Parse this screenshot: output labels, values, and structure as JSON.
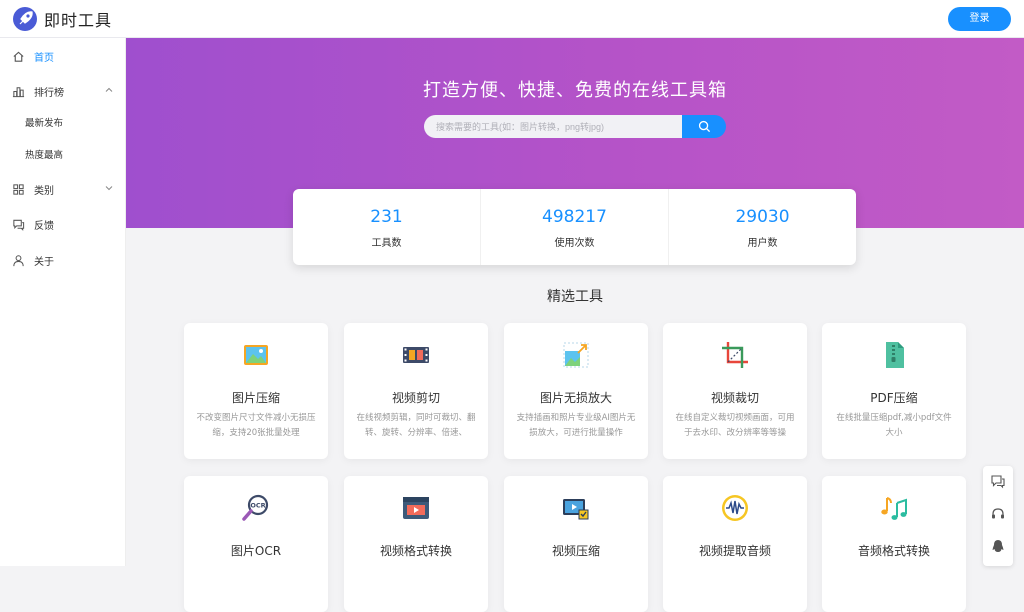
{
  "app": {
    "name": "即时工具"
  },
  "header": {
    "login_label": "登录"
  },
  "sidebar": {
    "items": [
      {
        "label": "首页",
        "icon": "home-icon",
        "active": true
      },
      {
        "label": "排行榜",
        "icon": "bar-chart-icon",
        "expanded": true,
        "children": [
          {
            "label": "最新发布"
          },
          {
            "label": "热度最高"
          }
        ]
      },
      {
        "label": "类别",
        "icon": "grid-icon",
        "expanded": false
      },
      {
        "label": "反馈",
        "icon": "feedback-icon"
      },
      {
        "label": "关于",
        "icon": "user-icon"
      }
    ]
  },
  "hero": {
    "title": "打造方便、快捷、免费的在线工具箱",
    "search_placeholder": "搜索需要的工具(如：图片转换，png转jpg)"
  },
  "stats": [
    {
      "value": "231",
      "label": "工具数"
    },
    {
      "value": "498217",
      "label": "使用次数"
    },
    {
      "value": "29030",
      "label": "用户数"
    }
  ],
  "featured": {
    "title": "精选工具",
    "tools": [
      {
        "title": "图片压缩",
        "desc": "不改变图片尺寸文件减小无损压缩，支持20张批量处理",
        "icon": "image-compress-icon"
      },
      {
        "title": "视频剪切",
        "desc": "在线视频剪辑，同时可裁切、翻转、旋转、分辨率、倍速、",
        "icon": "film-cut-icon"
      },
      {
        "title": "图片无损放大",
        "desc": "支持插画和照片专业级AI图片无损放大，可进行批量操作",
        "icon": "image-enlarge-icon"
      },
      {
        "title": "视频裁切",
        "desc": "在线自定义裁切视频画面，可用于去水印、改分辨率等等操",
        "icon": "crop-icon"
      },
      {
        "title": "PDF压缩",
        "desc": "在线批量压缩pdf,减小pdf文件大小",
        "icon": "zip-file-icon"
      },
      {
        "title": "图片OCR",
        "desc": "",
        "icon": "ocr-magnifier-icon"
      },
      {
        "title": "视频格式转换",
        "desc": "",
        "icon": "video-convert-icon"
      },
      {
        "title": "视频压缩",
        "desc": "",
        "icon": "video-compress-icon"
      },
      {
        "title": "视频提取音频",
        "desc": "",
        "icon": "audio-wave-icon"
      },
      {
        "title": "音频格式转换",
        "desc": "",
        "icon": "music-note-icon"
      }
    ]
  },
  "float_bar": {
    "icons": [
      "chat-icon",
      "headset-icon",
      "qq-penguin-icon"
    ]
  },
  "colors": {
    "accent": "#1890ff",
    "hero_start": "#9f4fce",
    "hero_end": "#c25bc6"
  }
}
